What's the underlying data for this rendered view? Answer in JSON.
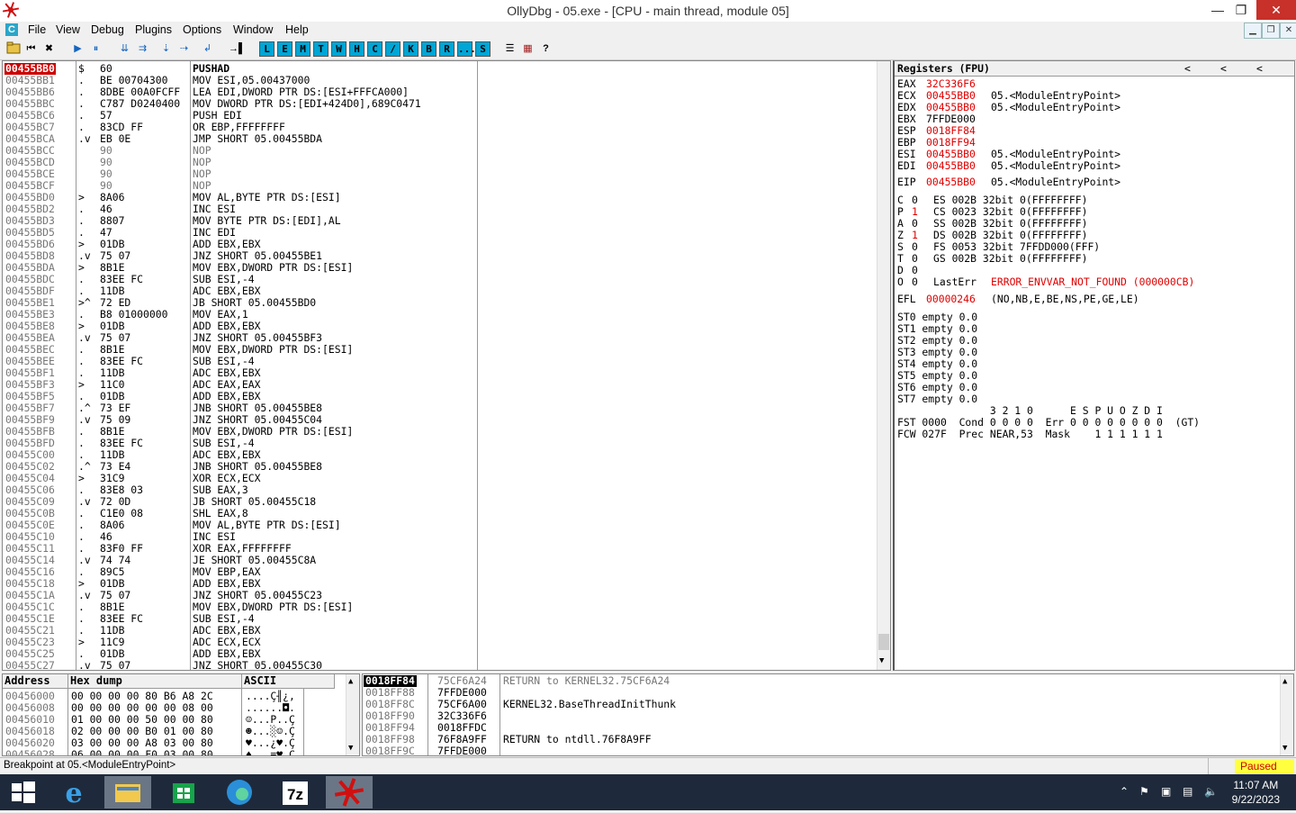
{
  "window": {
    "title": "OllyDbg - 05.exe - [CPU - main thread, module 05]",
    "minimize": "—",
    "restore": "❐",
    "close": "✕"
  },
  "menu": {
    "icon": "C",
    "items": [
      "File",
      "View",
      "Debug",
      "Plugins",
      "Options",
      "Window",
      "Help"
    ]
  },
  "toolbar": {
    "letters": [
      "L",
      "E",
      "M",
      "T",
      "W",
      "H",
      "C",
      "/",
      "K",
      "B",
      "R",
      "...",
      "S"
    ]
  },
  "cpu": {
    "rows": [
      {
        "addr": "00455BB0",
        "mark": "$",
        "hex": "60",
        "asm": "PUSHAD",
        "sel": true
      },
      {
        "addr": "00455BB1",
        "mark": ".",
        "hex": "BE 00704300",
        "asm": "MOV ESI,05.00437000"
      },
      {
        "addr": "00455BB6",
        "mark": ".",
        "hex": "8DBE 00A0FCFF",
        "asm": "LEA EDI,DWORD PTR DS:[ESI+FFFCA000]"
      },
      {
        "addr": "00455BBC",
        "mark": ".",
        "hex": "C787 D0240400",
        "asm": "MOV DWORD PTR DS:[EDI+424D0],689C0471"
      },
      {
        "addr": "00455BC6",
        "mark": ".",
        "hex": "57",
        "asm": "PUSH EDI"
      },
      {
        "addr": "00455BC7",
        "mark": ".",
        "hex": "83CD FF",
        "asm": "OR EBP,FFFFFFFF"
      },
      {
        "addr": "00455BCA",
        "mark": ".v",
        "hex": "EB 0E",
        "asm": "JMP SHORT 05.00455BDA"
      },
      {
        "addr": "00455BCC",
        "mark": "",
        "hex": "90",
        "asm": "NOP",
        "grey": true
      },
      {
        "addr": "00455BCD",
        "mark": "",
        "hex": "90",
        "asm": "NOP",
        "grey": true
      },
      {
        "addr": "00455BCE",
        "mark": "",
        "hex": "90",
        "asm": "NOP",
        "grey": true
      },
      {
        "addr": "00455BCF",
        "mark": "",
        "hex": "90",
        "asm": "NOP",
        "grey": true
      },
      {
        "addr": "00455BD0",
        "mark": ">",
        "hex": "8A06",
        "asm": "MOV AL,BYTE PTR DS:[ESI]"
      },
      {
        "addr": "00455BD2",
        "mark": ".",
        "hex": "46",
        "asm": "INC ESI"
      },
      {
        "addr": "00455BD3",
        "mark": ".",
        "hex": "8807",
        "asm": "MOV BYTE PTR DS:[EDI],AL"
      },
      {
        "addr": "00455BD5",
        "mark": ".",
        "hex": "47",
        "asm": "INC EDI"
      },
      {
        "addr": "00455BD6",
        "mark": ">",
        "hex": "01DB",
        "asm": "ADD EBX,EBX"
      },
      {
        "addr": "00455BD8",
        "mark": ".v",
        "hex": "75 07",
        "asm": "JNZ SHORT 05.00455BE1"
      },
      {
        "addr": "00455BDA",
        "mark": ">",
        "hex": "8B1E",
        "asm": "MOV EBX,DWORD PTR DS:[ESI]"
      },
      {
        "addr": "00455BDC",
        "mark": ".",
        "hex": "83EE FC",
        "asm": "SUB ESI,-4"
      },
      {
        "addr": "00455BDF",
        "mark": ".",
        "hex": "11DB",
        "asm": "ADC EBX,EBX"
      },
      {
        "addr": "00455BE1",
        "mark": ">^",
        "hex": "72 ED",
        "asm": "JB SHORT 05.00455BD0"
      },
      {
        "addr": "00455BE3",
        "mark": ".",
        "hex": "B8 01000000",
        "asm": "MOV EAX,1"
      },
      {
        "addr": "00455BE8",
        "mark": ">",
        "hex": "01DB",
        "asm": "ADD EBX,EBX"
      },
      {
        "addr": "00455BEA",
        "mark": ".v",
        "hex": "75 07",
        "asm": "JNZ SHORT 05.00455BF3"
      },
      {
        "addr": "00455BEC",
        "mark": ".",
        "hex": "8B1E",
        "asm": "MOV EBX,DWORD PTR DS:[ESI]"
      },
      {
        "addr": "00455BEE",
        "mark": ".",
        "hex": "83EE FC",
        "asm": "SUB ESI,-4"
      },
      {
        "addr": "00455BF1",
        "mark": ".",
        "hex": "11DB",
        "asm": "ADC EBX,EBX"
      },
      {
        "addr": "00455BF3",
        "mark": ">",
        "hex": "11C0",
        "asm": "ADC EAX,EAX"
      },
      {
        "addr": "00455BF5",
        "mark": ".",
        "hex": "01DB",
        "asm": "ADD EBX,EBX"
      },
      {
        "addr": "00455BF7",
        "mark": ".^",
        "hex": "73 EF",
        "asm": "JNB SHORT 05.00455BE8"
      },
      {
        "addr": "00455BF9",
        "mark": ".v",
        "hex": "75 09",
        "asm": "JNZ SHORT 05.00455C04"
      },
      {
        "addr": "00455BFB",
        "mark": ".",
        "hex": "8B1E",
        "asm": "MOV EBX,DWORD PTR DS:[ESI]"
      },
      {
        "addr": "00455BFD",
        "mark": ".",
        "hex": "83EE FC",
        "asm": "SUB ESI,-4"
      },
      {
        "addr": "00455C00",
        "mark": ".",
        "hex": "11DB",
        "asm": "ADC EBX,EBX"
      },
      {
        "addr": "00455C02",
        "mark": ".^",
        "hex": "73 E4",
        "asm": "JNB SHORT 05.00455BE8"
      },
      {
        "addr": "00455C04",
        "mark": ">",
        "hex": "31C9",
        "asm": "XOR ECX,ECX"
      },
      {
        "addr": "00455C06",
        "mark": ".",
        "hex": "83E8 03",
        "asm": "SUB EAX,3"
      },
      {
        "addr": "00455C09",
        "mark": ".v",
        "hex": "72 0D",
        "asm": "JB SHORT 05.00455C18"
      },
      {
        "addr": "00455C0B",
        "mark": ".",
        "hex": "C1E0 08",
        "asm": "SHL EAX,8"
      },
      {
        "addr": "00455C0E",
        "mark": ".",
        "hex": "8A06",
        "asm": "MOV AL,BYTE PTR DS:[ESI]"
      },
      {
        "addr": "00455C10",
        "mark": ".",
        "hex": "46",
        "asm": "INC ESI"
      },
      {
        "addr": "00455C11",
        "mark": ".",
        "hex": "83F0 FF",
        "asm": "XOR EAX,FFFFFFFF"
      },
      {
        "addr": "00455C14",
        "mark": ".v",
        "hex": "74 74",
        "asm": "JE SHORT 05.00455C8A"
      },
      {
        "addr": "00455C16",
        "mark": ".",
        "hex": "89C5",
        "asm": "MOV EBP,EAX"
      },
      {
        "addr": "00455C18",
        "mark": ">",
        "hex": "01DB",
        "asm": "ADD EBX,EBX"
      },
      {
        "addr": "00455C1A",
        "mark": ".v",
        "hex": "75 07",
        "asm": "JNZ SHORT 05.00455C23"
      },
      {
        "addr": "00455C1C",
        "mark": ".",
        "hex": "8B1E",
        "asm": "MOV EBX,DWORD PTR DS:[ESI]"
      },
      {
        "addr": "00455C1E",
        "mark": ".",
        "hex": "83EE FC",
        "asm": "SUB ESI,-4"
      },
      {
        "addr": "00455C21",
        "mark": ".",
        "hex": "11DB",
        "asm": "ADC EBX,EBX"
      },
      {
        "addr": "00455C23",
        "mark": ">",
        "hex": "11C9",
        "asm": "ADC ECX,ECX"
      },
      {
        "addr": "00455C25",
        "mark": ".",
        "hex": "01DB",
        "asm": "ADD EBX,EBX"
      },
      {
        "addr": "00455C27",
        "mark": ".v",
        "hex": "75 07",
        "asm": "JNZ SHORT 05.00455C30"
      }
    ]
  },
  "registers": {
    "title": "Registers (FPU)",
    "nav": [
      "<",
      "<",
      "<"
    ],
    "gp": [
      {
        "name": "EAX",
        "value": "32C336F6",
        "note": ""
      },
      {
        "name": "ECX",
        "value": "00455BB0",
        "note": "05.<ModuleEntryPoint>"
      },
      {
        "name": "EDX",
        "value": "00455BB0",
        "note": "05.<ModuleEntryPoint>"
      },
      {
        "name": "EBX",
        "value": "7FFDE000",
        "note": "",
        "black": true
      },
      {
        "name": "ESP",
        "value": "0018FF84",
        "note": ""
      },
      {
        "name": "EBP",
        "value": "0018FF94",
        "note": ""
      },
      {
        "name": "ESI",
        "value": "00455BB0",
        "note": "05.<ModuleEntryPoint>"
      },
      {
        "name": "EDI",
        "value": "00455BB0",
        "note": "05.<ModuleEntryPoint>"
      }
    ],
    "eip": {
      "name": "EIP",
      "value": "00455BB0",
      "note": "05.<ModuleEntryPoint>"
    },
    "flags": [
      {
        "f": "C",
        "v": "0",
        "seg": "ES 002B 32bit 0(FFFFFFFF)"
      },
      {
        "f": "P",
        "v": "1",
        "seg": "CS 0023 32bit 0(FFFFFFFF)",
        "red": true
      },
      {
        "f": "A",
        "v": "0",
        "seg": "SS 002B 32bit 0(FFFFFFFF)"
      },
      {
        "f": "Z",
        "v": "1",
        "seg": "DS 002B 32bit 0(FFFFFFFF)",
        "red": true
      },
      {
        "f": "S",
        "v": "0",
        "seg": "FS 0053 32bit 7FFDD000(FFF)"
      },
      {
        "f": "T",
        "v": "0",
        "seg": "GS 002B 32bit 0(FFFFFFFF)"
      },
      {
        "f": "D",
        "v": "0",
        "seg": ""
      }
    ],
    "lasterr": {
      "f": "O",
      "v": "0",
      "label": "LastErr",
      "value": "ERROR_ENVVAR_NOT_FOUND (000000CB)"
    },
    "efl": {
      "label": "EFL",
      "value": "00000246",
      "note": "(NO,NB,E,BE,NS,PE,GE,LE)"
    },
    "st": [
      "ST0 empty 0.0",
      "ST1 empty 0.0",
      "ST2 empty 0.0",
      "ST3 empty 0.0",
      "ST4 empty 0.0",
      "ST5 empty 0.0",
      "ST6 empty 0.0",
      "ST7 empty 0.0"
    ],
    "fpu_header": "               3 2 1 0      E S P U O Z D I",
    "fst": "FST 0000  Cond 0 0 0 0  Err 0 0 0 0 0 0 0 0  (GT)",
    "fcw": "FCW 027F  Prec NEAR,53  Mask    1 1 1 1 1 1"
  },
  "dump": {
    "headers": [
      "Address",
      "Hex dump",
      "ASCII"
    ],
    "rows": [
      {
        "addr": "00456000",
        "hex": "00 00 00 00 80 B6 A8 2C",
        "ascii": "....Ç╢¿,"
      },
      {
        "addr": "00456008",
        "hex": "00 00 00 00 00 00 08 00",
        "ascii": "......◘."
      },
      {
        "addr": "00456010",
        "hex": "01 00 00 00 50 00 00 80",
        "ascii": "☺...P..Ç"
      },
      {
        "addr": "00456018",
        "hex": "02 00 00 00 B0 01 00 80",
        "ascii": "☻...░☺.Ç"
      },
      {
        "addr": "00456020",
        "hex": "03 00 00 00 A8 03 00 80",
        "ascii": "♥...¿♥.Ç"
      },
      {
        "addr": "00456028",
        "hex": "06 00 00 00 F0 03 00 80",
        "ascii": "♠...≡♥.Ç"
      }
    ]
  },
  "stack": {
    "rows": [
      {
        "addr": "0018FF84",
        "val": "75CF6A24",
        "comment": "RETURN to KERNEL32.75CF6A24",
        "sel": true
      },
      {
        "addr": "0018FF88",
        "val": "7FFDE000",
        "comment": ""
      },
      {
        "addr": "0018FF8C",
        "val": "75CF6A00",
        "comment": "KERNEL32.BaseThreadInitThunk"
      },
      {
        "addr": "0018FF90",
        "val": "32C336F6",
        "comment": ""
      },
      {
        "addr": "0018FF94",
        "val": "0018FFDC",
        "comment": ""
      },
      {
        "addr": "0018FF98",
        "val": "76F8A9FF",
        "comment": "RETURN to ntdll.76F8A9FF"
      },
      {
        "addr": "0018FF9C",
        "val": "7FFDE000",
        "comment": ""
      }
    ]
  },
  "status": {
    "message": "Breakpoint at 05.<ModuleEntryPoint>",
    "state": "Paused"
  },
  "taskbar": {
    "time": "11:07 AM",
    "date": "9/22/2023"
  },
  "colors": {
    "accent_red": "#e00000",
    "toolbar_letter_bg": "#00a6d6",
    "paused_bg": "#ffff40",
    "taskbar_bg": "#1e2a3b"
  }
}
